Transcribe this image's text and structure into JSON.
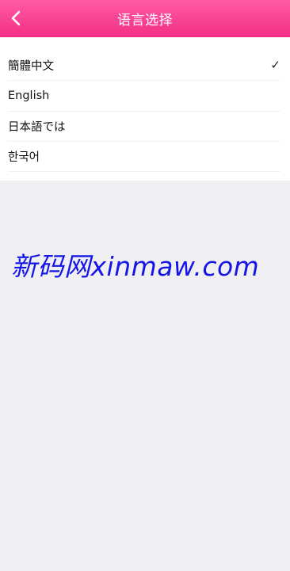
{
  "header": {
    "title": "语言选择",
    "background_top": "#ff5aa6",
    "background_bottom": "#f32f86",
    "back_icon": "chevron-left-icon"
  },
  "languages": {
    "items": [
      {
        "label": "簡體中文",
        "selected": true
      },
      {
        "label": "English",
        "selected": false
      },
      {
        "label": "日本語では",
        "selected": false
      },
      {
        "label": "한국어",
        "selected": false
      }
    ],
    "check_mark": "✓"
  },
  "watermark": {
    "text": "新码网xinmaw.com",
    "color": "#1515e6"
  }
}
